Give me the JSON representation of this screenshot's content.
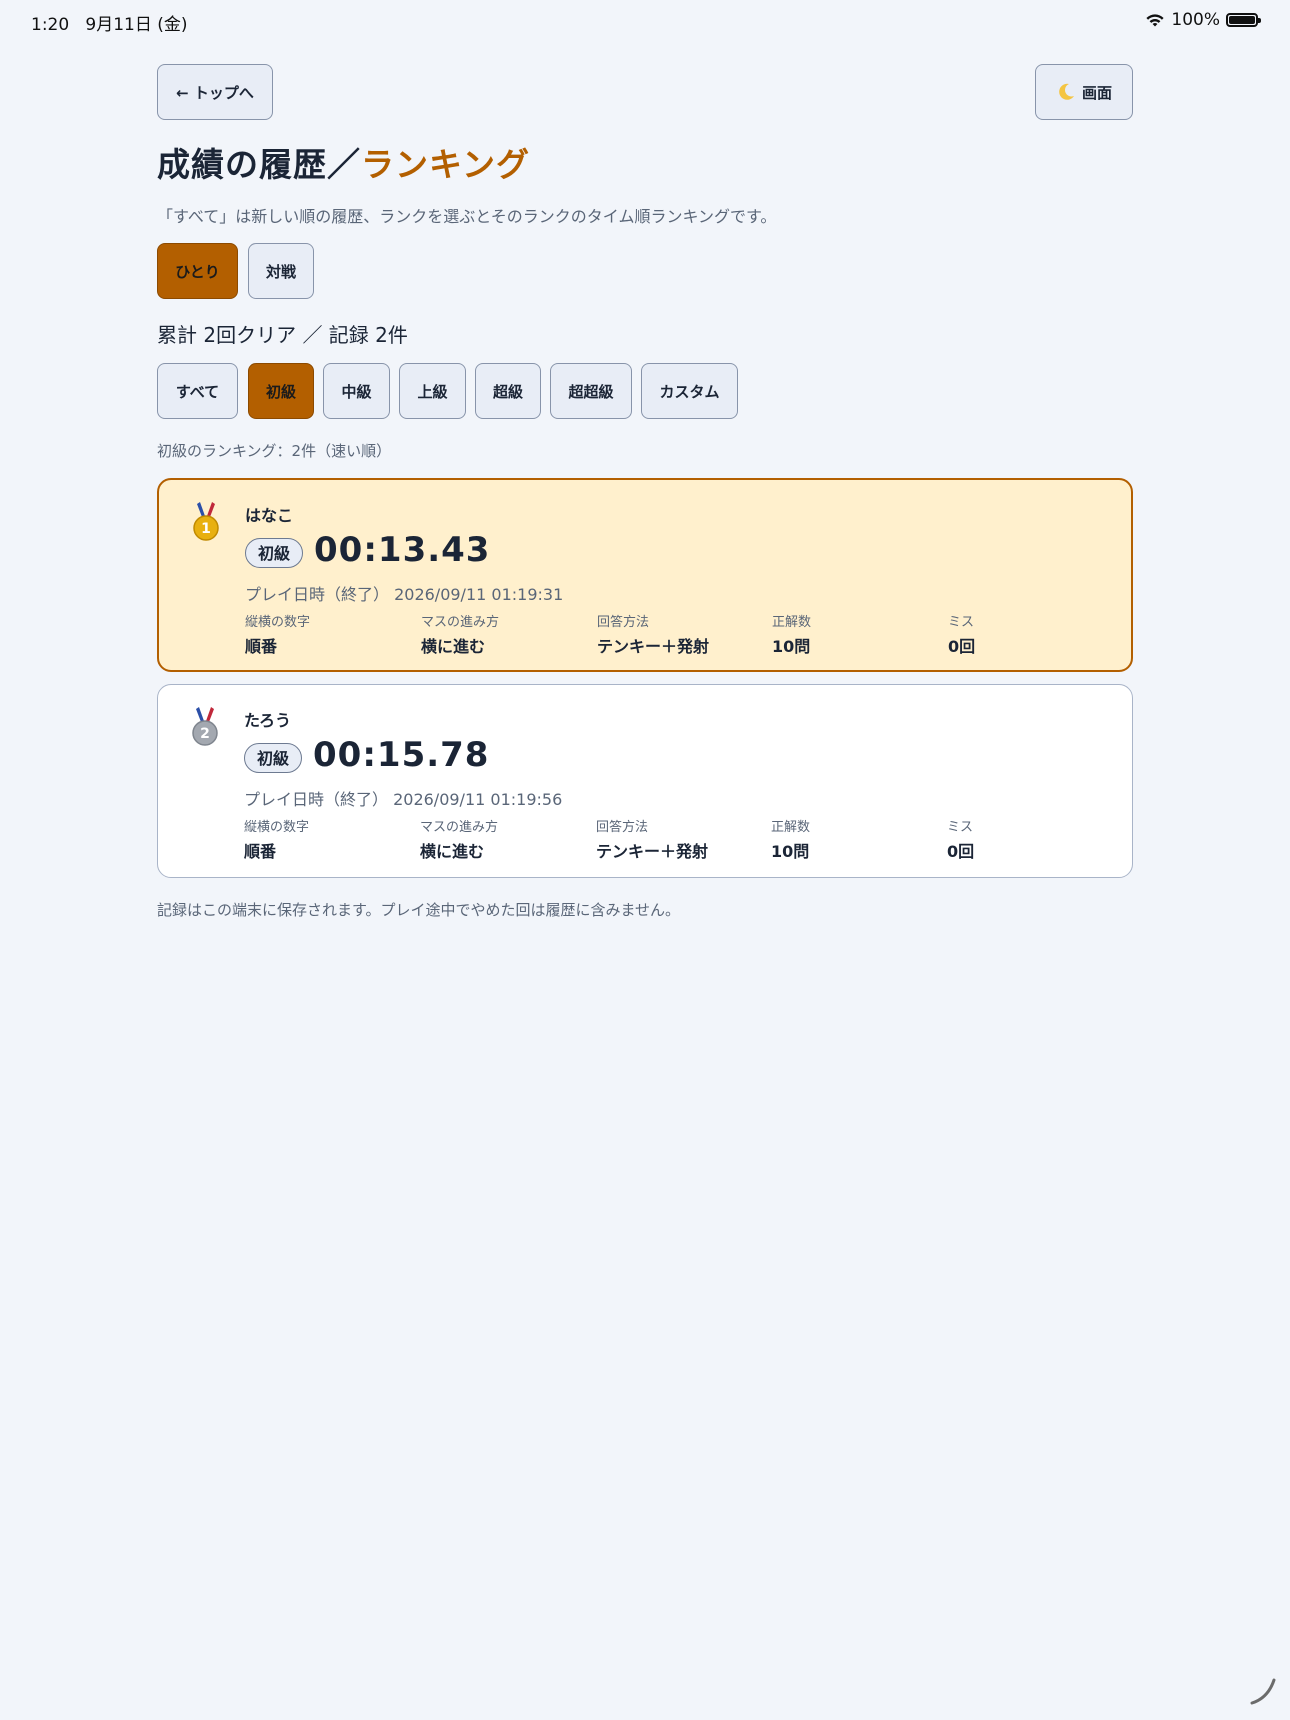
{
  "status_bar": {
    "time": "1:20",
    "date": "9月11日 (金)",
    "battery": "100%"
  },
  "header": {
    "back_label": "← トップへ",
    "theme_label": "画面",
    "theme_icon": "moon-icon"
  },
  "page": {
    "title_main": "成績の履歴／",
    "title_accent": "ランキング",
    "accent_color": "#b35f00",
    "description": "「すべて」は新しい順の履歴、ランクを選ぶとそのランクのタイム順ランキングです。"
  },
  "mode_tabs": [
    {
      "label": "ひとり",
      "active": true
    },
    {
      "label": "対戦",
      "active": false
    }
  ],
  "summary": "累計 2回クリア ／ 記録 2件",
  "rank_tabs": [
    {
      "label": "すべて",
      "active": false
    },
    {
      "label": "初級",
      "active": true
    },
    {
      "label": "中級",
      "active": false
    },
    {
      "label": "上級",
      "active": false
    },
    {
      "label": "超級",
      "active": false
    },
    {
      "label": "超超級",
      "active": false
    },
    {
      "label": "カスタム",
      "active": false
    }
  ],
  "ranking_caption": "初級のランキング：2件（速い順）",
  "stat_labels": {
    "numbers": "縦横の数字",
    "movement": "マスの進み方",
    "answer": "回答方法",
    "correct": "正解数",
    "miss": "ミス"
  },
  "records": [
    {
      "place": "1",
      "medal": "gold-medal-icon",
      "player": "はなこ",
      "rank": "初級",
      "time": "00:13.43",
      "played": "プレイ日時（終了） 2026/09/11 01:19:31",
      "numbers": "順番",
      "movement": "横に進む",
      "answer": "テンキー＋発射",
      "correct": "10問",
      "miss": "0回"
    },
    {
      "place": "2",
      "medal": "silver-medal-icon",
      "player": "たろう",
      "rank": "初級",
      "time": "00:15.78",
      "played": "プレイ日時（終了） 2026/09/11 01:19:56",
      "numbers": "順番",
      "movement": "横に進む",
      "answer": "テンキー＋発射",
      "correct": "10問",
      "miss": "0回"
    }
  ],
  "footnote": "記録はこの端末に保存されます。プレイ途中でやめた回は履歴に含みません。"
}
